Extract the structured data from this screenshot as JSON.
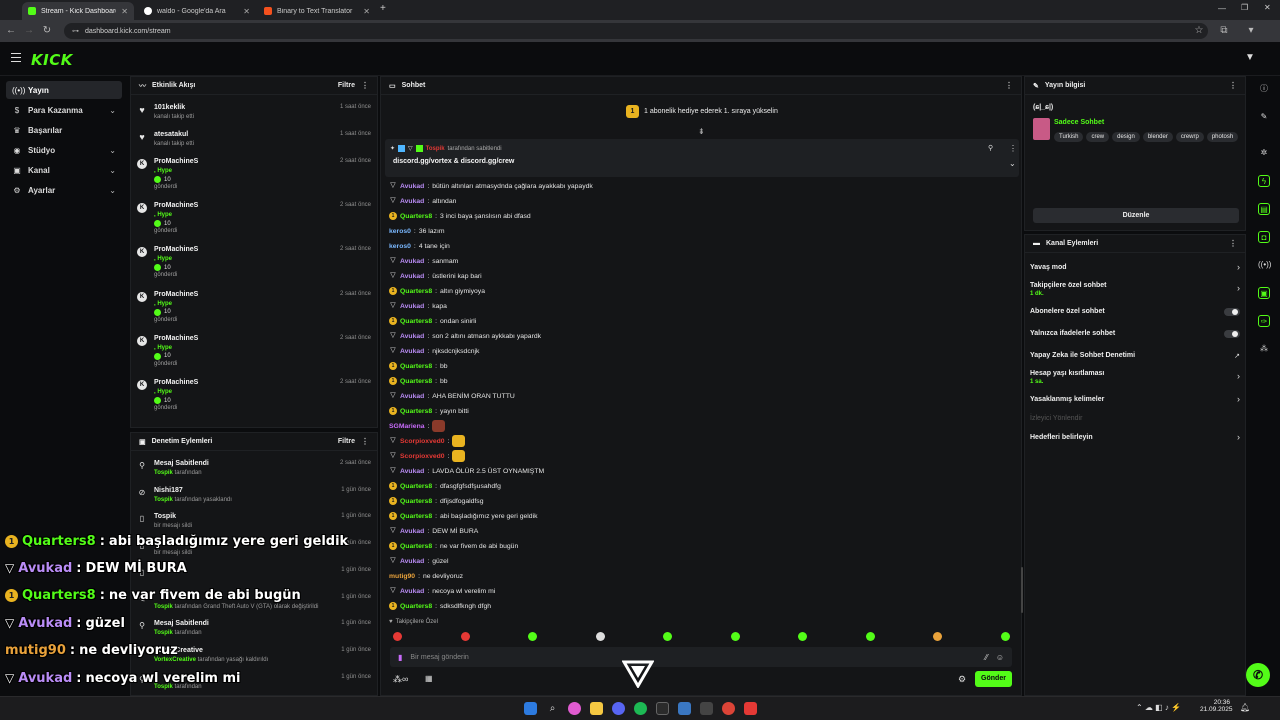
{
  "browser": {
    "tabs": [
      {
        "title": "Stream - Kick Dashboard",
        "active": true,
        "color": "#53fc18"
      },
      {
        "title": "waldo - Google'da Ara",
        "active": false,
        "color": "#ffffff"
      },
      {
        "title": "Binary to Text Translator",
        "active": false,
        "color": "#f4511e"
      }
    ],
    "url": "dashboard.kick.com/stream"
  },
  "header": {
    "logo": "KICK"
  },
  "nav": {
    "items": [
      {
        "label": "Yayın",
        "icon": "broadcast-icon",
        "chevron": false
      },
      {
        "label": "Para Kazanma",
        "icon": "dollar-icon",
        "chevron": true
      },
      {
        "label": "Başarılar",
        "icon": "trophy-icon",
        "chevron": false
      },
      {
        "label": "Stüdyo",
        "icon": "palette-icon",
        "chevron": true
      },
      {
        "label": "Kanal",
        "icon": "channel-icon",
        "chevron": true
      },
      {
        "label": "Ayarlar",
        "icon": "gear-icon",
        "chevron": true
      }
    ]
  },
  "activity": {
    "title": "Etkinlik Akışı",
    "filter": "Filtre",
    "events": [
      {
        "name": "101keklik",
        "sub": "kanalı takip etti",
        "time": "1 saat önce",
        "kind": "follow"
      },
      {
        "name": "atesatakul",
        "sub": "kanalı takip etti",
        "time": "1 saat önce",
        "kind": "follow"
      },
      {
        "name": "ProMachineS",
        "hype": ", Hype",
        "amount": "10",
        "sent": "gönderdi",
        "time": "2 saat önce",
        "kind": "kick"
      },
      {
        "name": "ProMachineS",
        "hype": ", Hype",
        "amount": "10",
        "sent": "gönderdi",
        "time": "2 saat önce",
        "kind": "kick"
      },
      {
        "name": "ProMachineS",
        "hype": ", Hype",
        "amount": "10",
        "sent": "gönderdi",
        "time": "2 saat önce",
        "kind": "kick"
      },
      {
        "name": "ProMachineS",
        "hype": ", Hype",
        "amount": "10",
        "sent": "gönderdi",
        "time": "2 saat önce",
        "kind": "kick"
      },
      {
        "name": "ProMachineS",
        "hype": ", Hype",
        "amount": "10",
        "sent": "gönderdi",
        "time": "2 saat önce",
        "kind": "kick"
      },
      {
        "name": "ProMachineS",
        "hype": ", Hype",
        "amount": "10",
        "sent": "gönderdi",
        "time": "2 saat önce",
        "kind": "kick"
      }
    ]
  },
  "moderation": {
    "title": "Denetim Eylemleri",
    "filter": "Filtre",
    "actions": [
      {
        "name": "Mesaj Sabitlendi",
        "by": "Tospik",
        "rest": " tarafından",
        "time": "2 saat önce",
        "icon": "pin-icon"
      },
      {
        "name": "Nishi187",
        "by": "Tospik",
        "rest": " tarafından yasaklandı",
        "time": "1 gün önce",
        "icon": "ban-icon"
      },
      {
        "name": "Tospik",
        "by": "",
        "rest": "bir mesajı sildi",
        "time": "1 gün önce",
        "icon": "trash-icon"
      },
      {
        "name": "",
        "by": "",
        "rest": "bir mesajı sildi",
        "time": "1 gün önce",
        "icon": "trash-icon"
      },
      {
        "name": "",
        "by": "",
        "rest": "",
        "time": "1 gün önce",
        "icon": "trash-icon"
      },
      {
        "name": "",
        "by": "Tospik",
        "rest": " tarafından Grand Theft Auto V (GTA) olarak değiştirildi",
        "time": "1 gün önce",
        "icon": "edit-icon"
      },
      {
        "name": "Mesaj Sabitlendi",
        "by": "Tospik",
        "rest": " tarafından",
        "time": "1 gün önce",
        "icon": "pin-icon"
      },
      {
        "name": "VortexCreative",
        "by": "VortexCreative",
        "rest": " tarafından yasağı kaldırıldı",
        "time": "1 gün önce",
        "icon": "unban-icon"
      },
      {
        "name": "",
        "by": "Tospik",
        "rest": " tarafından",
        "time": "1 gün önce",
        "icon": "pin-icon"
      }
    ]
  },
  "chat": {
    "title": "Sohbet",
    "banner": "1 abonelik hediye ederek 1. sıraya yükselin",
    "pinned": {
      "by": "Tospik",
      "by_suffix": "tarafından sabitlendi",
      "text": "discord.gg/vortex & discord.gg/crew"
    },
    "messages": [
      {
        "user": "Avukad",
        "text": "bütün altınları atmasydnda çağlara ayakkabı yapaydk",
        "color": "#b98cf5",
        "badge": "mod"
      },
      {
        "user": "Avukad",
        "text": "altından",
        "color": "#b98cf5",
        "badge": "mod"
      },
      {
        "user": "Quarters8",
        "text": "3 inci baya şanslısın abi dfasd",
        "color": "#53fc18",
        "badge": "gold"
      },
      {
        "user": "keros0",
        "text": "36 lazım",
        "color": "#7ab8ff",
        "badge": ""
      },
      {
        "user": "keros0",
        "text": "4 tane için",
        "color": "#7ab8ff",
        "badge": ""
      },
      {
        "user": "Avukad",
        "text": "sanmam",
        "color": "#b98cf5",
        "badge": "mod"
      },
      {
        "user": "Avukad",
        "text": "üstlerini kap bari",
        "color": "#b98cf5",
        "badge": "mod"
      },
      {
        "user": "Quarters8",
        "text": "altın giymiyoya",
        "color": "#53fc18",
        "badge": "gold"
      },
      {
        "user": "Avukad",
        "text": "kapa",
        "color": "#b98cf5",
        "badge": "mod"
      },
      {
        "user": "Quarters8",
        "text": "ondan sinirli",
        "color": "#53fc18",
        "badge": "gold"
      },
      {
        "user": "Avukad",
        "text": "son 2 altını atmasn aykkabı yapardk",
        "color": "#b98cf5",
        "badge": "mod"
      },
      {
        "user": "Avukad",
        "text": "njksdcnjksdcnjk",
        "color": "#b98cf5",
        "badge": "mod"
      },
      {
        "user": "Quarters8",
        "text": "bb",
        "color": "#53fc18",
        "badge": "gold"
      },
      {
        "user": "Quarters8",
        "text": "bb",
        "color": "#53fc18",
        "badge": "gold"
      },
      {
        "user": "Avukad",
        "text": "AHA BENİM ORAN TUTTU",
        "color": "#b98cf5",
        "badge": "mod"
      },
      {
        "user": "Quarters8",
        "text": "yayın bitti",
        "color": "#53fc18",
        "badge": "gold"
      },
      {
        "user": "SGMariena",
        "text": "",
        "color": "#c86bfa",
        "badge": "",
        "emote": true
      },
      {
        "user": "Scorpioxved0",
        "text": "",
        "color": "#e53935",
        "badge": "mod",
        "emote": true
      },
      {
        "user": "Scorpioxved0",
        "text": "",
        "color": "#e53935",
        "badge": "mod",
        "emote": true
      },
      {
        "user": "Avukad",
        "text": "LAVDA ÖLÜR 2.5 ÜST OYNAMIŞTM",
        "color": "#b98cf5",
        "badge": "mod"
      },
      {
        "user": "Quarters8",
        "text": "dfasgfgfsdfşusahdfg",
        "color": "#53fc18",
        "badge": "gold"
      },
      {
        "user": "Quarters8",
        "text": "dfijsdfogaldfsg",
        "color": "#53fc18",
        "badge": "gold"
      },
      {
        "user": "Quarters8",
        "text": "abi başladığımız yere geri geldik",
        "color": "#53fc18",
        "badge": "gold"
      },
      {
        "user": "Avukad",
        "text": "DEW Mİ BURA",
        "color": "#b98cf5",
        "badge": "mod"
      },
      {
        "user": "Quarters8",
        "text": "ne var fivem de abi bugün",
        "color": "#53fc18",
        "badge": "gold"
      },
      {
        "user": "Avukad",
        "text": "güzel",
        "color": "#b98cf5",
        "badge": "mod"
      },
      {
        "user": "mutig90",
        "text": "ne devliyoruz",
        "color": "#e9a23b",
        "badge": ""
      },
      {
        "user": "Avukad",
        "text": "necoya wl verelim mi",
        "color": "#b98cf5",
        "badge": "mod"
      },
      {
        "user": "Quarters8",
        "text": "sdksdlfkngh dfgh",
        "color": "#53fc18",
        "badge": "gold"
      }
    ],
    "followers_only": "Takipçilere Özel",
    "input_placeholder": "Bir mesaj gönderin",
    "send": "Gönder"
  },
  "stream_info": {
    "title": "Yayın bilgisi",
    "stream_title": "(ɕ|_ɕ|)",
    "category": "Sadece Sohbet",
    "tags": [
      "Turkish",
      "crew",
      "design",
      "blender",
      "crewrp",
      "photosh"
    ],
    "edit": "Düzenle"
  },
  "channel_actions": {
    "title": "Kanal Eylemleri",
    "items": [
      {
        "label": "Yavaş mod",
        "sub": "",
        "control": "chevron"
      },
      {
        "label": "Takipçilere özel sohbet",
        "sub": "1 dk.",
        "control": "chevron"
      },
      {
        "label": "Abonelere özel sohbet",
        "sub": "",
        "control": "toggle"
      },
      {
        "label": "Yalnızca ifadelerle sohbet",
        "sub": "",
        "control": "toggle"
      },
      {
        "label": "Yapay Zeka ile Sohbet Denetimi",
        "sub": "",
        "control": "external"
      },
      {
        "label": "Hesap yaşı kısıtlaması",
        "sub": "1 sa.",
        "control": "chevron"
      },
      {
        "label": "Yasaklanmış kelimeler",
        "sub": "",
        "control": "chevron"
      },
      {
        "label": "İzleyici Yönlendir",
        "sub": "",
        "control": "disabled"
      },
      {
        "label": "Hedefleri belirleyin",
        "sub": "",
        "control": "chevron"
      }
    ]
  },
  "overlay": {
    "lines": [
      {
        "user": "Quarters8",
        "text": "abi başladığımız yere geri geldik",
        "color": "#53fc18",
        "badge": "gold"
      },
      {
        "user": "Avukad",
        "text": "DEW Mİ BURA",
        "color": "#b98cf5",
        "badge": "mod"
      },
      {
        "user": "Quarters8",
        "text": "ne var fivem de abi bugün",
        "color": "#53fc18",
        "badge": "gold"
      },
      {
        "user": "Avukad",
        "text": "güzel",
        "color": "#b98cf5",
        "badge": "mod"
      },
      {
        "user": "mutig90",
        "text": "ne devliyoruz",
        "color": "#e9a23b",
        "badge": ""
      },
      {
        "user": "Avukad",
        "text": "necoya wl verelim mi",
        "color": "#b98cf5",
        "badge": "mod"
      },
      {
        "user": "Quarters8",
        "text": "sdksdlfkngh dfgh",
        "color": "#53fc18",
        "badge": "gold"
      }
    ]
  },
  "taskbar": {
    "time": "20:36",
    "date": "21.09.2025"
  },
  "colors": {
    "accent": "#53fc18",
    "gold": "#e9b320",
    "panel": "#141517"
  }
}
